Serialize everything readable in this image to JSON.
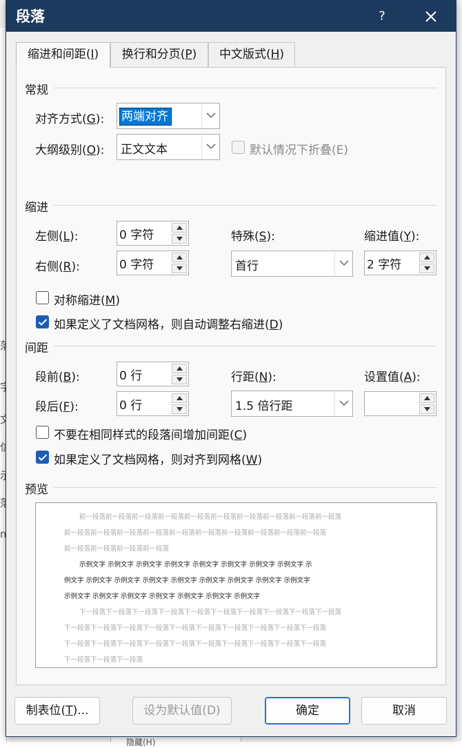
{
  "dialog": {
    "title": "段落",
    "help": "?"
  },
  "tabs": [
    {
      "label": "缩进和间距(I)",
      "text": "缩进和间距(",
      "key": "I",
      "tail": ")"
    },
    {
      "label": "换行和分页(P)",
      "text": "换行和分页(",
      "key": "P",
      "tail": ")"
    },
    {
      "label": "中文版式(H)",
      "text": "中文版式(",
      "key": "H",
      "tail": ")"
    }
  ],
  "general": {
    "heading": "常规",
    "alignment": {
      "label": "对齐方式(",
      "key": "G",
      "tail": "):",
      "value": "两端对齐"
    },
    "outline": {
      "label": "大纲级别(",
      "key": "O",
      "tail": "):",
      "value": "正文文本"
    },
    "collapse": {
      "label": "默认情况下折叠(E)",
      "checked": false,
      "enabled": false
    }
  },
  "indent": {
    "heading": "缩进",
    "left": {
      "label": "左侧(",
      "key": "L",
      "tail": "):",
      "value": "0 字符"
    },
    "right": {
      "label": "右侧(",
      "key": "R",
      "tail": "):",
      "value": "0 字符"
    },
    "special": {
      "label": "特殊(",
      "key": "S",
      "tail": "):",
      "value": "首行"
    },
    "by": {
      "label": "缩进值(",
      "key": "Y",
      "tail": "):",
      "value": "2 字符"
    },
    "mirror": {
      "label": "对称缩进(",
      "key": "M",
      "tail": ")",
      "checked": false
    },
    "auto_adjust": {
      "label": "如果定义了文档网格，则自动调整右缩进(",
      "key": "D",
      "tail": ")",
      "checked": true
    }
  },
  "spacing": {
    "heading": "间距",
    "before": {
      "label": "段前(",
      "key": "B",
      "tail": "):",
      "value": "0 行"
    },
    "after": {
      "label": "段后(",
      "key": "F",
      "tail": "):",
      "value": "0 行"
    },
    "line_spacing": {
      "label": "行距(",
      "key": "N",
      "tail": "):",
      "value": "1.5 倍行距"
    },
    "at": {
      "label": "设置值(",
      "key": "A",
      "tail": "):",
      "value": ""
    },
    "no_space_same_style": {
      "label": "不要在相同样式的段落间增加间距(",
      "key": "C",
      "tail": ")",
      "checked": false
    },
    "snap_grid": {
      "label": "如果定义了文档网格，则对齐到网格(",
      "key": "W",
      "tail": ")",
      "checked": true
    }
  },
  "preview": {
    "heading": "预览",
    "prev_lines": [
      "前一段落前一段落前一段落前一段落前一段落前一段落前一段落前一段落前一段落前一段落",
      "前一段落前一段落前一段落前一段落前一段落前一段落前一段落前一段落前一段落前一段落",
      "前一段落前一段落前一段落前一段落"
    ],
    "sample_lines": [
      "示例文字  示例文字  示例文字  示例文字  示例文字  示例文字  示例文字  示例文字  示",
      "例文字  示例文字  示例文字  示例文字  示例文字  示例文字  示例文字  示例文字  示例文字",
      "示例文字  示例文字  示例文字  示例文字  示例文字  示例文字  示例文字"
    ],
    "next_lines": [
      "下一段落下一段落下一段落下一段落下一段落下一段落下一段落下一段落下一段落下一段落",
      "下一段落下一段落下一段落下一段落下一段落下一段落下一段落下一段落下一段落下一段落",
      "下一段落下一段落下一段落下一段落下一段落下一段落下一段落下一段落下一段落下一段落",
      "下一段落下一段落下一段落"
    ]
  },
  "buttons": {
    "tabs": {
      "text": "制表位(",
      "key": "T",
      "tail": ")..."
    },
    "set_default": "设为默认值(D)",
    "ok": "确定",
    "cancel": "取消"
  },
  "background": {
    "fragments": [
      "落",
      "字",
      "文",
      "信",
      "示",
      "落",
      "m"
    ],
    "bottom_text": "隐藏(H)"
  },
  "colors": {
    "titlebar": "#1c3a5e",
    "selection": "#0078d7",
    "checkbox_on": "#1c5db3",
    "primary_border": "#2f6fc4"
  }
}
